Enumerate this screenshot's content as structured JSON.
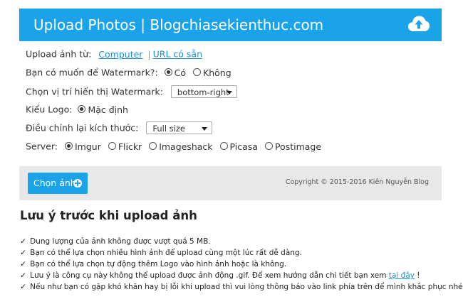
{
  "header": {
    "title": "Upload Photos | Blogchiasekienthuc.com",
    "icon": "cloud-upload-icon"
  },
  "form": {
    "upload_from": {
      "label": "Upload ảnh từ:",
      "options": [
        "Computer",
        "URL có sẵn"
      ],
      "selected": "Computer"
    },
    "watermark": {
      "label": "Bạn có muốn để Watermark?:",
      "options": [
        "Có",
        "Không"
      ],
      "selected": "Có"
    },
    "watermark_position": {
      "label": "Chọn vị trí hiển thị Watermark:",
      "value": "bottom-right"
    },
    "logo_type": {
      "label": "Kiểu Logo:",
      "options": [
        "Mặc định"
      ],
      "selected": "Mặc định"
    },
    "resize": {
      "label": "Điều chỉnh lại kích thước:",
      "value": "Full size"
    },
    "server": {
      "label": "Server:",
      "options": [
        "Imgur",
        "Flickr",
        "Imageshack",
        "Picasa",
        "Postimage"
      ],
      "selected": "Imgur"
    }
  },
  "footer": {
    "choose_button": "Chọn ảnh",
    "copyright": "Copyright © 2015-2016 Kiên Nguyễn Blog"
  },
  "notes": {
    "title": "Lưu ý trước khi upload ảnh",
    "check": "✓",
    "items": [
      "Dung lượng của ảnh không được vượt quá 5 MB.",
      "Bạn có thể lựa chọn nhiều hình ảnh để upload cùng một lúc rất dễ dàng.",
      "Bạn có thể lựa chọn tự động thêm Logo vào hình ảnh hoặc là không.",
      "Lưu ý là công cụ này không thể upload được ảnh động .gif. Để xem hướng dẫn chi tiết bạn xem",
      "Nếu như bạn có gặp khó khăn hay bị lỗi khi upload thì vui lòng thông báo vào link phía trên để mình khắc phục nhé !"
    ],
    "item4_link": "tại đây",
    "item4_end": " !"
  },
  "colors": {
    "accent": "#1aa3e8",
    "link": "#1a8fd9",
    "footer_bg": "#e8e8e8"
  }
}
